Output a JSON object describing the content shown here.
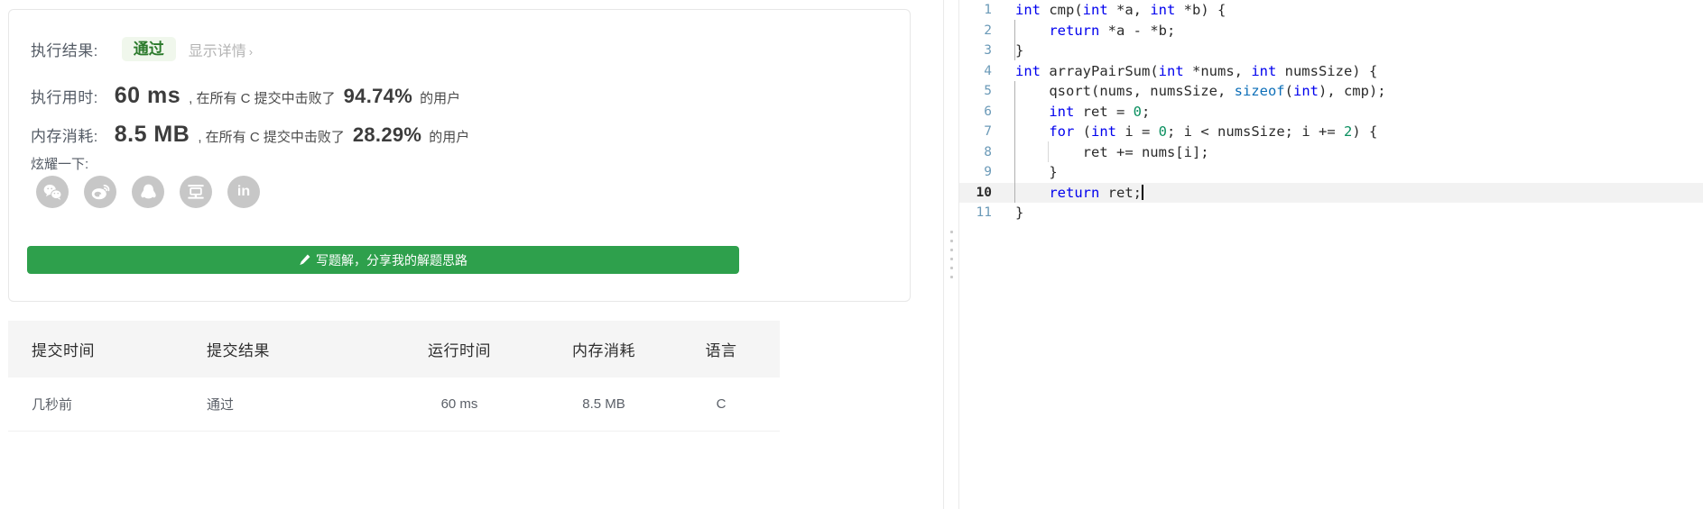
{
  "result_card": {
    "result_label": "执行结果:",
    "status_badge": "通过",
    "detail_link": "显示详情",
    "detail_chevron": "›",
    "runtime": {
      "label": "执行用时:",
      "value": "60 ms",
      "middle": ", 在所有 C 提交中击败了",
      "percent": "94.74%",
      "tail": "的用户"
    },
    "memory": {
      "label": "内存消耗:",
      "value": "8.5 MB",
      "middle": ", 在所有 C 提交中击败了",
      "percent": "28.29%",
      "tail": "的用户"
    },
    "share": {
      "label": "炫耀一下:",
      "icons": [
        {
          "name": "wechat-icon",
          "glyph": ""
        },
        {
          "name": "weibo-icon",
          "glyph": ""
        },
        {
          "name": "qq-icon",
          "glyph": ""
        },
        {
          "name": "douban-icon",
          "glyph": "豆"
        },
        {
          "name": "linkedin-icon",
          "glyph": "in"
        }
      ]
    },
    "write_button": {
      "label": "写题解，分享我的解题思路",
      "icon": "pencil-icon",
      "color": "#2ea04c"
    }
  },
  "submissions_table": {
    "headers": [
      "提交时间",
      "提交结果",
      "运行时间",
      "内存消耗",
      "语言"
    ],
    "rows": [
      {
        "time": "几秒前",
        "result": "通过",
        "runtime": "60 ms",
        "memory": "8.5 MB",
        "language": "C"
      }
    ],
    "pass_color": "#5cb85c"
  },
  "code_editor": {
    "language": "C",
    "active_line": 10,
    "lines": [
      {
        "n": "1",
        "tokens": [
          {
            "t": "int",
            "c": "kw"
          },
          {
            "t": " cmp(",
            "c": "pl"
          },
          {
            "t": "int",
            "c": "kw"
          },
          {
            "t": " *a, ",
            "c": "pl"
          },
          {
            "t": "int",
            "c": "kw"
          },
          {
            "t": " *b) {",
            "c": "pl"
          }
        ]
      },
      {
        "n": "2",
        "tokens": [
          {
            "t": "    ",
            "c": "pl"
          },
          {
            "t": "return",
            "c": "kw"
          },
          {
            "t": " *a - *b;",
            "c": "pl"
          }
        ]
      },
      {
        "n": "3",
        "tokens": [
          {
            "t": "}",
            "c": "pl"
          }
        ]
      },
      {
        "n": "4",
        "tokens": [
          {
            "t": "int",
            "c": "kw"
          },
          {
            "t": " arrayPairSum(",
            "c": "pl"
          },
          {
            "t": "int",
            "c": "kw"
          },
          {
            "t": " *nums, ",
            "c": "pl"
          },
          {
            "t": "int",
            "c": "kw"
          },
          {
            "t": " numsSize) {",
            "c": "pl"
          }
        ]
      },
      {
        "n": "5",
        "tokens": [
          {
            "t": "    qsort(nums, numsSize, ",
            "c": "pl"
          },
          {
            "t": "sizeof",
            "c": "kw2"
          },
          {
            "t": "(",
            "c": "pl"
          },
          {
            "t": "int",
            "c": "kw"
          },
          {
            "t": "), cmp);",
            "c": "pl"
          }
        ]
      },
      {
        "n": "6",
        "tokens": [
          {
            "t": "    ",
            "c": "pl"
          },
          {
            "t": "int",
            "c": "kw"
          },
          {
            "t": " ret = ",
            "c": "pl"
          },
          {
            "t": "0",
            "c": "num"
          },
          {
            "t": ";",
            "c": "pl"
          }
        ]
      },
      {
        "n": "7",
        "tokens": [
          {
            "t": "    ",
            "c": "pl"
          },
          {
            "t": "for",
            "c": "kw"
          },
          {
            "t": " (",
            "c": "pl"
          },
          {
            "t": "int",
            "c": "kw"
          },
          {
            "t": " i = ",
            "c": "pl"
          },
          {
            "t": "0",
            "c": "num"
          },
          {
            "t": "; i < numsSize; i += ",
            "c": "pl"
          },
          {
            "t": "2",
            "c": "num"
          },
          {
            "t": ") {",
            "c": "pl"
          }
        ]
      },
      {
        "n": "8",
        "tokens": [
          {
            "t": "        ret += nums[i];",
            "c": "pl"
          }
        ]
      },
      {
        "n": "9",
        "tokens": [
          {
            "t": "    }",
            "c": "pl"
          }
        ]
      },
      {
        "n": "10",
        "tokens": [
          {
            "t": "    ",
            "c": "pl"
          },
          {
            "t": "return",
            "c": "kw"
          },
          {
            "t": " ret;",
            "c": "pl"
          }
        ],
        "caret": true
      },
      {
        "n": "11",
        "tokens": [
          {
            "t": "}",
            "c": "pl"
          }
        ]
      }
    ]
  },
  "drag_handle": {
    "name": "panel-resize-handle",
    "dots": 6
  }
}
